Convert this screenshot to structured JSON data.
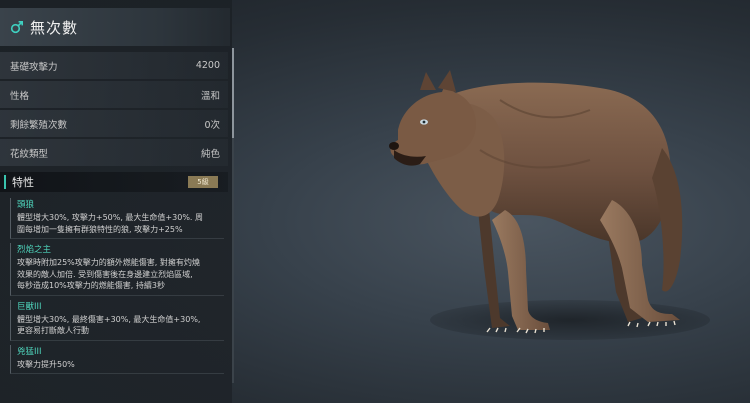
{
  "header": {
    "title": "無次數"
  },
  "stats": [
    {
      "label": "基礎攻擊力",
      "value": "4200"
    },
    {
      "label": "性格",
      "value": "溫和"
    },
    {
      "label": "剩餘繁殖次數",
      "value": "0次"
    },
    {
      "label": "花紋類型",
      "value": "純色"
    }
  ],
  "traits": {
    "label": "特性",
    "count": "5級",
    "items": [
      {
        "name": "頭狼",
        "desc": "體型增大30%, 攻擊力+50%, 最大生命值+30%. 周\n圍每增加一隻擁有群狼特性的狼, 攻擊力+25%"
      },
      {
        "name": "烈焰之主",
        "desc": "攻擊時附加25%攻擊力的額外燃能傷害, 對擁有灼燒\n效果的敵人加倍. 受到傷害後在身邊建立烈焰區域,\n每秒造成10%攻擊力的燃能傷害, 持續3秒"
      },
      {
        "name": "巨獸III",
        "desc": "體型增大30%, 最終傷害+30%, 最大生命值+30%,\n更容易打斷敵人行動"
      },
      {
        "name": "兇猛III",
        "desc": "攻擊力提升50%"
      }
    ]
  },
  "colors": {
    "accent": "#39c4ae",
    "trait_name": "#4fd6bd",
    "badge": "#8a7a55"
  }
}
